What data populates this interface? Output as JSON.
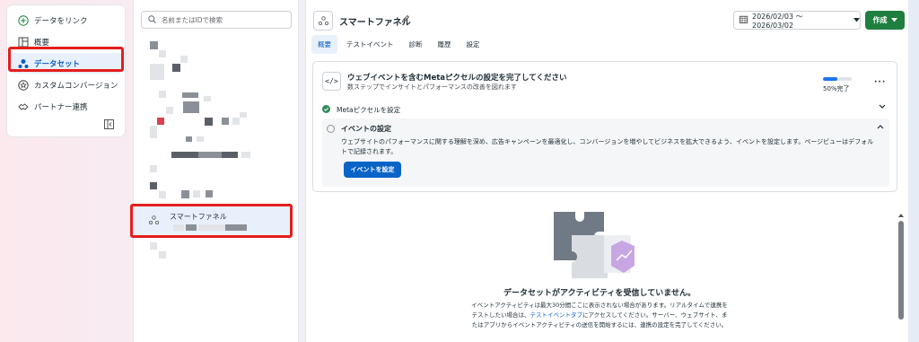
{
  "nav": {
    "link_label": "データをリンク",
    "items": [
      {
        "label": "概要",
        "icon": "overview-icon"
      },
      {
        "label": "データセット",
        "icon": "dataset-icon",
        "active": true
      },
      {
        "label": "カスタムコンバージョン",
        "icon": "star-icon"
      },
      {
        "label": "パートナー連携",
        "icon": "handshake-icon"
      }
    ]
  },
  "list": {
    "search_placeholder": "名前またはIDで検索",
    "selected_item": "スマートファネル"
  },
  "header": {
    "title": "スマートファネル",
    "date_range": "2026/02/03 ～ 2026/03/02",
    "create_label": "作成"
  },
  "tabs": [
    "概要",
    "テストイベント",
    "診断",
    "履歴",
    "設定"
  ],
  "setup_card": {
    "title": "ウェブイベントを含むMetaピクセルの設定を完了してください",
    "subtitle": "数ステップでインサイトとパフォーマンスの改善を図れます",
    "progress_percent": 50,
    "progress_text": "50%完了",
    "step1_label": "Metaピクセルを設定",
    "step2_title": "イベントの設定",
    "step2_desc": "ウェブサイトのパフォーマンスに関する理解を深め、広告キャンペーンを最適化し、コンバージョンを増やしてビジネスを拡大できるよう、イベントを設定します。ページビューはデフォルトで記録されます。",
    "step2_button": "イベントを設定"
  },
  "empty_state": {
    "title": "データセットがアクティビティを受信していません。",
    "desc_1": "イベントアクティビティは最大30分間ここに表示されない場合があります。リアルタイムで連携をテストしたい場合は、",
    "desc_link": "テストイベントタブ",
    "desc_2": "にアクセスしてください。サーバー、ウェブサイト、またはアプリからイベントアクティビティの送信を開始するには、連携の設定を完了してください。"
  },
  "colors": {
    "primary": "#0a64c7",
    "create_green": "#1e7f3e",
    "highlight_red": "#e41e1e"
  }
}
